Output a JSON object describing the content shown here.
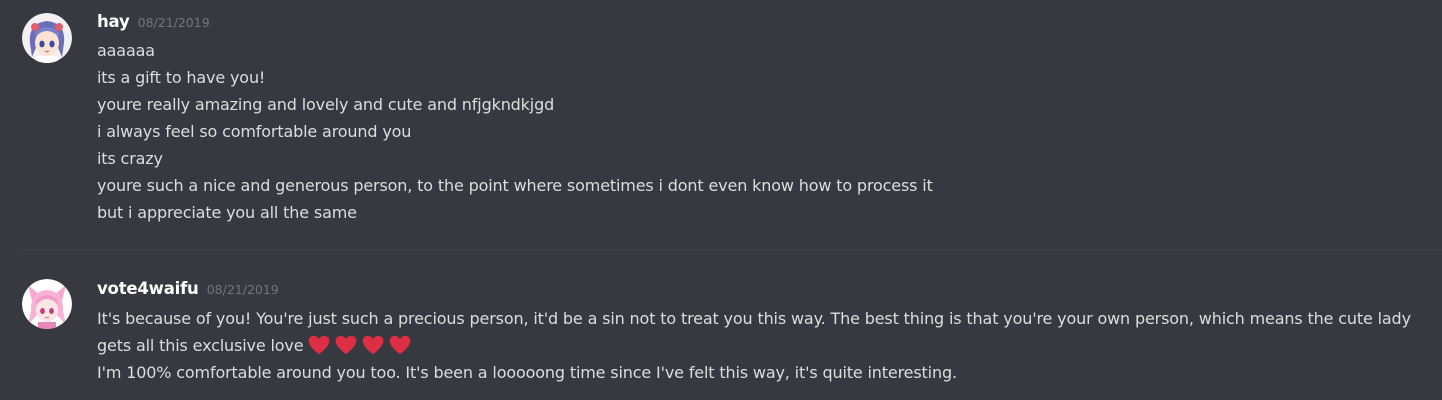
{
  "messages": [
    {
      "author": "hay",
      "timestamp": "08/21/2019",
      "avatar_icon": "anime-avatar-hay",
      "lines": [
        "aaaaaa",
        "its a gift to have you!",
        "youre really amazing and lovely and cute and nfjgkndkjgd",
        "i always feel so comfortable around you",
        "its crazy",
        "youre such a nice and generous person, to the point where sometimes i dont even know how to process it",
        "but i appreciate you all the same"
      ]
    },
    {
      "author": "vote4waifu",
      "timestamp": "08/21/2019",
      "avatar_icon": "anime-avatar-vote4waifu",
      "lines": [
        "It's because of you! You're just such a precious person, it'd be a sin not to treat you this way. The best thing is that you're your own person, which means the cute lady gets all this exclusive love",
        "I'm 100% comfortable around you too. It's been a looooong time since I've felt this way, it's quite interesting."
      ],
      "emoji": [
        "heart",
        "heart",
        "heart",
        "heart"
      ]
    }
  ],
  "colors": {
    "background": "#36393f",
    "username": "#ffffff",
    "timestamp": "#72767d",
    "message_text": "#dcddde",
    "heart": "#dd2e44"
  }
}
